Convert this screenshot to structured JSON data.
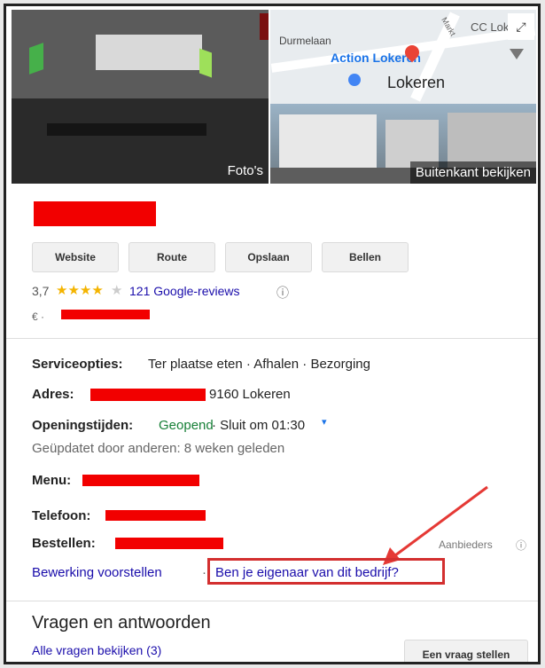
{
  "photos": {
    "left_label": "Foto's",
    "right_label": "Buitenkant bekijken",
    "map_labels": [
      "Durmelaan",
      "CC Lok",
      "Action Lokeren",
      "Lokeren",
      "Markt"
    ]
  },
  "actions": [
    "Website",
    "Route",
    "Opslaan",
    "Bellen"
  ],
  "rating": {
    "value": "3,7",
    "stars": "★★★★",
    "star_fraction": 0.7,
    "reviews": "121 Google-reviews",
    "info_icon": "ⓘ"
  },
  "price": "€ ·",
  "info": {
    "service_label": "Serviceopties:",
    "service_value": "Ter plaatse eten · Afhalen · Bezorging",
    "address_label": "Adres:",
    "address_value": "9160 Lokeren",
    "hours_label": "Openingstijden:",
    "hours_open": "Geopend",
    "hours_close": "· Sluit om 01:30",
    "updated": "Geüpdatet door anderen: 8 weken geleden",
    "menu_label": "Menu:",
    "phone_label": "Telefoon:",
    "order_label": "Bestellen:",
    "providers": "Aanbieders"
  },
  "links": {
    "suggest_edit": "Bewerking voorstellen",
    "separator": "·",
    "claim": "Ben je eigenaar van dit bedrijf?"
  },
  "qa": {
    "title": "Vragen en antwoorden",
    "view_all": "Alle vragen bekijken (3)",
    "ask_button": "Een vraag stellen"
  },
  "colors": {
    "redaction": "#f20000",
    "link": "#1a0dab",
    "star": "#f4b400",
    "open": "#188038",
    "highlight_box": "#d32f2f"
  }
}
